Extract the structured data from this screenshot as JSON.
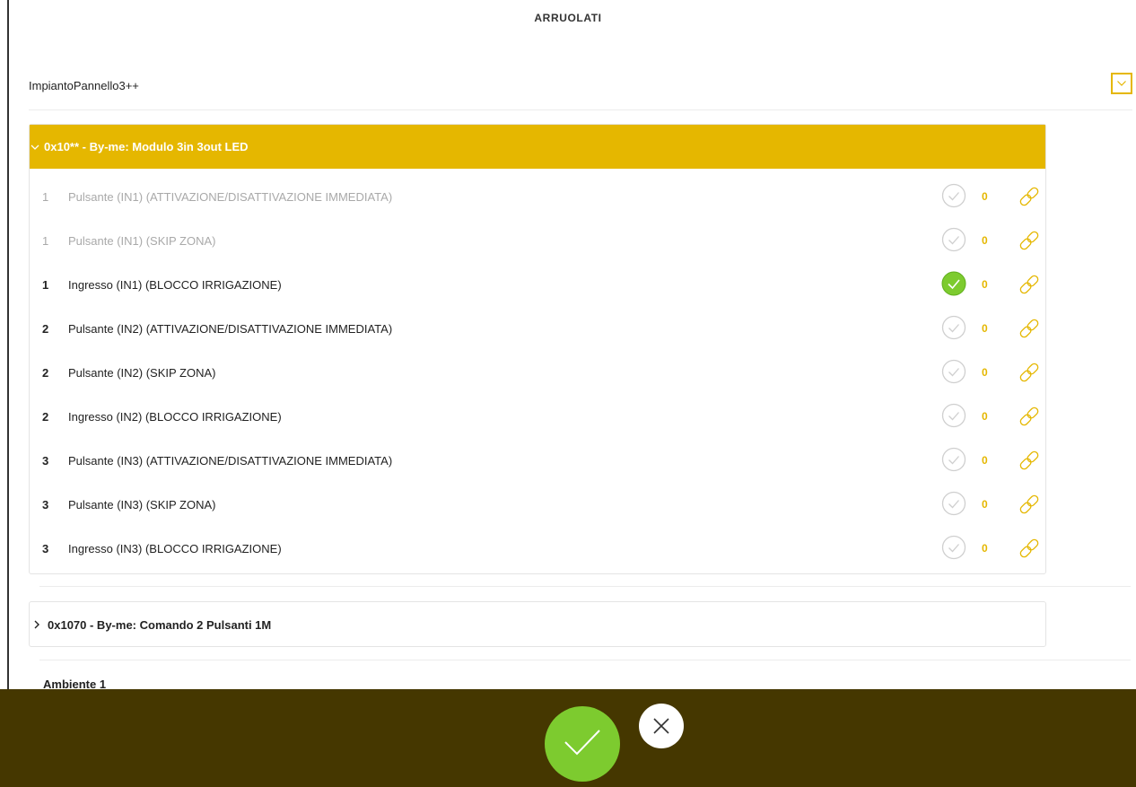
{
  "page": {
    "title": "ARRUOLATI"
  },
  "system": {
    "name": "ImpiantoPannello3++",
    "toggle_icon": "chevron-down-icon"
  },
  "devices": [
    {
      "title": "0x10** - By-me: Modulo 3in 3out LED",
      "expanded": true,
      "header_color": "#e5b700",
      "rows": [
        {
          "number": "1",
          "label": "Pulsante (IN1) (ATTIVAZIONE/DISATTIVAZIONE IMMEDIATA)",
          "enabled": false,
          "selected": false,
          "count": "0"
        },
        {
          "number": "1",
          "label": "Pulsante (IN1) (SKIP ZONA)",
          "enabled": false,
          "selected": false,
          "count": "0"
        },
        {
          "number": "1",
          "label": "Ingresso (IN1) (BLOCCO IRRIGAZIONE)",
          "enabled": true,
          "selected": true,
          "count": "0"
        },
        {
          "number": "2",
          "label": "Pulsante (IN2) (ATTIVAZIONE/DISATTIVAZIONE IMMEDIATA)",
          "enabled": true,
          "selected": false,
          "count": "0"
        },
        {
          "number": "2",
          "label": "Pulsante (IN2) (SKIP ZONA)",
          "enabled": true,
          "selected": false,
          "count": "0"
        },
        {
          "number": "2",
          "label": "Ingresso (IN2) (BLOCCO IRRIGAZIONE)",
          "enabled": true,
          "selected": false,
          "count": "0"
        },
        {
          "number": "3",
          "label": "Pulsante (IN3) (ATTIVAZIONE/DISATTIVAZIONE IMMEDIATA)",
          "enabled": true,
          "selected": false,
          "count": "0"
        },
        {
          "number": "3",
          "label": "Pulsante (IN3) (SKIP ZONA)",
          "enabled": true,
          "selected": false,
          "count": "0"
        },
        {
          "number": "3",
          "label": "Ingresso (IN3) (BLOCCO IRRIGAZIONE)",
          "enabled": true,
          "selected": false,
          "count": "0"
        }
      ]
    },
    {
      "title": "0x1070 - By-me: Comando 2 Pulsanti 1M",
      "expanded": false
    }
  ],
  "environment": {
    "label": "Ambiente 1"
  },
  "footer": {
    "confirm_icon": "checkmark-icon",
    "cancel_icon": "close-icon",
    "background": "#453700",
    "confirm_color": "#7dcb2f"
  },
  "colors": {
    "accent": "#e5b700",
    "selected_check": "#7dcb2f",
    "disabled_text": "#a9a9a9"
  }
}
